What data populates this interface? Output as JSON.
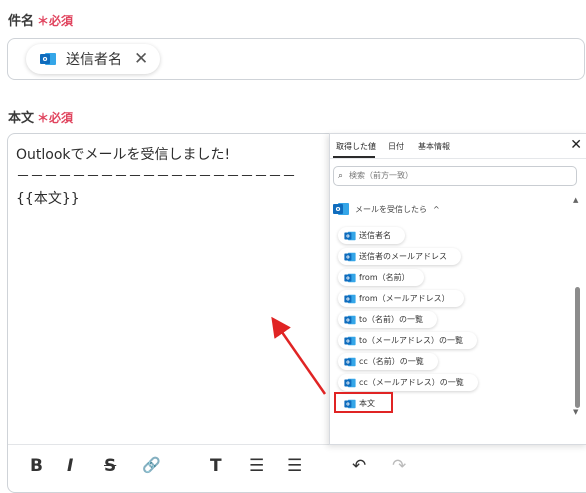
{
  "title_field": {
    "label": "件名",
    "required": "＊必須",
    "chip_label": "送信者名",
    "chip_remove": "✕"
  },
  "body_field": {
    "label": "本文",
    "required": "＊必須",
    "content": "Outlookでメールを受信しました!\n－－－－－－－－－－－－－－－－－－－－\n{{本文}}"
  },
  "toolbar": {
    "bold": "B",
    "italic": "I",
    "strike": "S",
    "link": "🔗",
    "heading": "T",
    "bullet_list": "☰",
    "ordered_list": "☰",
    "undo": "↶",
    "redo": "↷"
  },
  "panel": {
    "tabs": [
      "取得した値",
      "日付",
      "基本情報"
    ],
    "close": "✕",
    "search_placeholder": "検索（前方一致）",
    "section_title": "メールを受信したら",
    "section_caret": "^",
    "items": [
      "送信者名",
      "送信者のメールアドレス",
      "from（名前）",
      "from（メールアドレス）",
      "to（名前）の一覧",
      "to（メールアドレス）の一覧",
      "cc（名前）の一覧",
      "cc（メールアドレス）の一覧",
      "本文"
    ],
    "highlighted_item": "本文"
  },
  "colors": {
    "required": "#e0445e",
    "annotation": "#e02424",
    "outlook_blue": "#0f6cbd"
  },
  "icons": {
    "outlook": "outlook-icon",
    "search": "search-icon",
    "close": "close-icon"
  }
}
